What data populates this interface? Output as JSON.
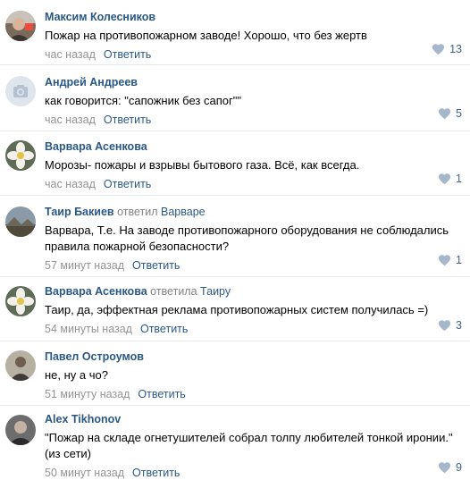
{
  "comments": [
    {
      "author": "Максим Колесников",
      "reply_text": "",
      "reply_to": "",
      "text": "Пожар на противопожарном заводе! Хорошо, что без жертв",
      "time": "час назад",
      "reply_label": "Ответить",
      "likes": "13",
      "avatar": "photo-man"
    },
    {
      "author": "Андрей Андреев",
      "reply_text": "",
      "reply_to": "",
      "text": "как говорится: \"сапожник без сапог\"\"",
      "time": "час назад",
      "reply_label": "Ответить",
      "likes": "5",
      "avatar": "camera-placeholder"
    },
    {
      "author": "Варвара Асенкова",
      "reply_text": "",
      "reply_to": "",
      "text": "Морозы- пожары и взрывы бытового газа. Всё, как всегда.",
      "time": "час назад",
      "reply_label": "Ответить",
      "likes": "1",
      "avatar": "flower-photo"
    },
    {
      "author": "Таир Бакиев",
      "reply_text": "ответил",
      "reply_to": "Варваре",
      "text": "Варвара, Т.е. На заводе противопожарного оборудования не соблюдались правила пожарной безопасности?",
      "time": "57 минут назад",
      "reply_label": "Ответить",
      "likes": "1",
      "avatar": "landscape-photo"
    },
    {
      "author": "Варвара Асенкова",
      "reply_text": "ответила",
      "reply_to": "Таиру",
      "text": "Таир, да, эффектная реклама противопожарных систем получилась =)",
      "time": "54 минуты назад",
      "reply_label": "Ответить",
      "likes": "3",
      "avatar": "flower-photo"
    },
    {
      "author": "Павел Остроумов",
      "reply_text": "",
      "reply_to": "",
      "text": "не, ну а чо?",
      "time": "51 минуту назад",
      "reply_label": "Ответить",
      "likes": "",
      "avatar": "man-photo"
    },
    {
      "author": "Alex Tikhonov",
      "reply_text": "",
      "reply_to": "",
      "text": "\"Пожар на складе огнетушителей собрал толпу любителей тонкой иронии.\" (из сети)",
      "time": "50 минут назад",
      "reply_label": "Ответить",
      "likes": "9",
      "avatar": "person-photo"
    }
  ],
  "colors": {
    "link": "#2a5885",
    "like": "#42648b",
    "muted": "#939393",
    "divider": "#e7e8ec"
  },
  "icons": {
    "like": "heart-icon"
  }
}
